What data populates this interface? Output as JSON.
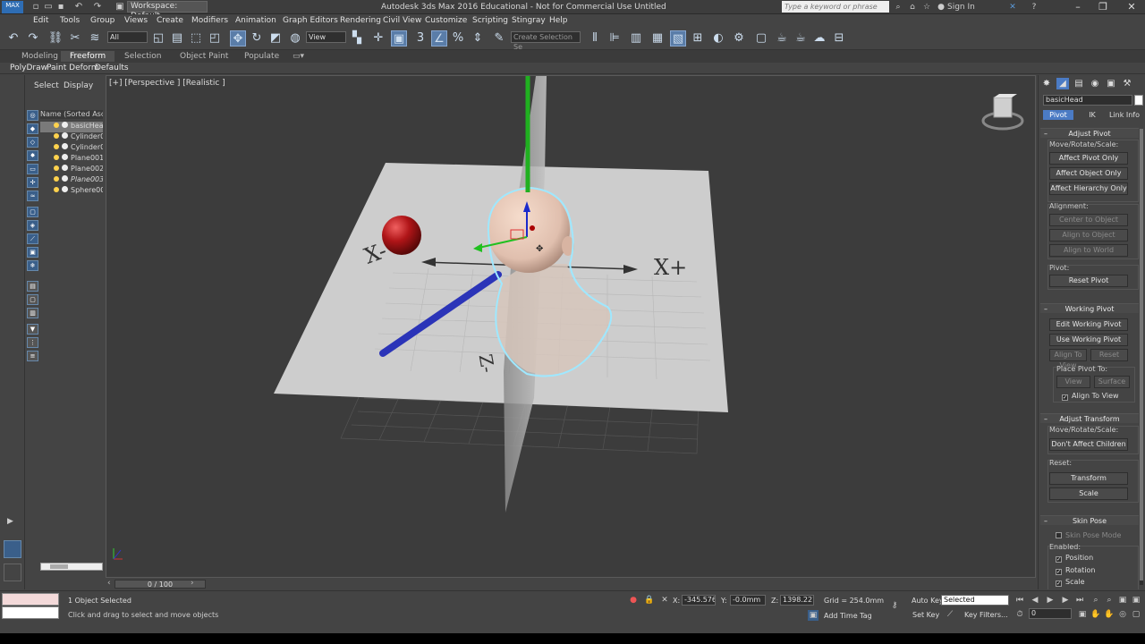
{
  "app": {
    "title": "Autodesk 3ds Max 2016 Educational - Not for Commercial Use   Untitled",
    "workspace": "Workspace: Default",
    "search_placeholder": "Type a keyword or phrase",
    "sign_in": "Sign In"
  },
  "menu": [
    "Edit",
    "Tools",
    "Group",
    "Views",
    "Create",
    "Modifiers",
    "Animation",
    "Graph Editors",
    "Rendering",
    "Civil View",
    "Customize",
    "Scripting",
    "Stingray",
    "Help"
  ],
  "toolbar": {
    "selection_filter": "All",
    "ref_coord": "View",
    "named_selection_placeholder": "Create Selection Se"
  },
  "ribbon": {
    "tabs": [
      "Modeling",
      "Freeform",
      "Selection",
      "Object Paint",
      "Populate"
    ],
    "active_tab": "Freeform",
    "subtabs": [
      "PolyDraw",
      "Paint Deform",
      "Defaults"
    ]
  },
  "scene_explorer": {
    "tabs": [
      "Select",
      "Display"
    ],
    "column_header": "Name (Sorted Ascending)",
    "items": [
      "basicHead",
      "Cylinder001",
      "Cylinder002",
      "Plane001",
      "Plane002",
      "Plane003",
      "Sphere001"
    ],
    "selected_index": 0
  },
  "viewport": {
    "label": "[+] [Perspective ] [Realistic ]"
  },
  "command_panel": {
    "object_name": "basicHead",
    "hierarchy_tabs": [
      "Pivot",
      "IK",
      "Link Info"
    ],
    "adjust_pivot": {
      "title": "Adjust Pivot",
      "move_rotate_scale": "Move/Rotate/Scale:",
      "affect_pivot_only": "Affect Pivot Only",
      "affect_object_only": "Affect Object Only",
      "affect_hierarchy_only": "Affect Hierarchy Only",
      "alignment": "Alignment:",
      "center_to_object": "Center to Object",
      "align_to_object": "Align to Object",
      "align_to_world": "Align to World",
      "pivot": "Pivot:",
      "reset_pivot": "Reset Pivot"
    },
    "working_pivot": {
      "title": "Working Pivot",
      "edit": "Edit Working Pivot",
      "use": "Use Working Pivot",
      "align_to_view": "Align To View",
      "reset": "Reset",
      "place_pivot_to": "Place Pivot To:",
      "view": "View",
      "surface": "Surface",
      "align_to_view_chk": "Align To View"
    },
    "adjust_transform": {
      "title": "Adjust Transform",
      "move_rotate_scale": "Move/Rotate/Scale:",
      "dont_affect_children": "Don't Affect Children",
      "reset": "Reset:",
      "transform": "Transform",
      "scale": "Scale"
    },
    "skin_pose": {
      "title": "Skin Pose",
      "skin_pose_mode": "Skin Pose Mode",
      "enabled": "Enabled:",
      "position": "Position",
      "rotation": "Rotation",
      "scale": "Scale"
    }
  },
  "time_slider": "0 / 100",
  "status": {
    "selection": "1 Object Selected",
    "prompt": "Click and drag to select and move objects",
    "x_label": "X:",
    "x": "-345.576m",
    "y_label": "Y:",
    "y": "-0.0mm",
    "z_label": "Z:",
    "z": "1398.227m",
    "grid": "Grid = 254.0mm",
    "add_time_tag": "Add Time Tag",
    "auto_key": "Auto Key",
    "set_key": "Set Key",
    "key_mode": "Selected",
    "key_filters": "Key Filters...",
    "frame": "0"
  },
  "scene_labels": {
    "x_neg": "X-",
    "x_pos": "X+",
    "z_neg": "Z-"
  },
  "colors": {
    "bg": "#444444",
    "viewport_bg": "#3c3c3c",
    "accent": "#4b7bc4",
    "selection_outline": "#9fe8ff",
    "sphere": "#c0181c",
    "axis_x": "#2b34b8",
    "axis_y": "#20b020"
  }
}
